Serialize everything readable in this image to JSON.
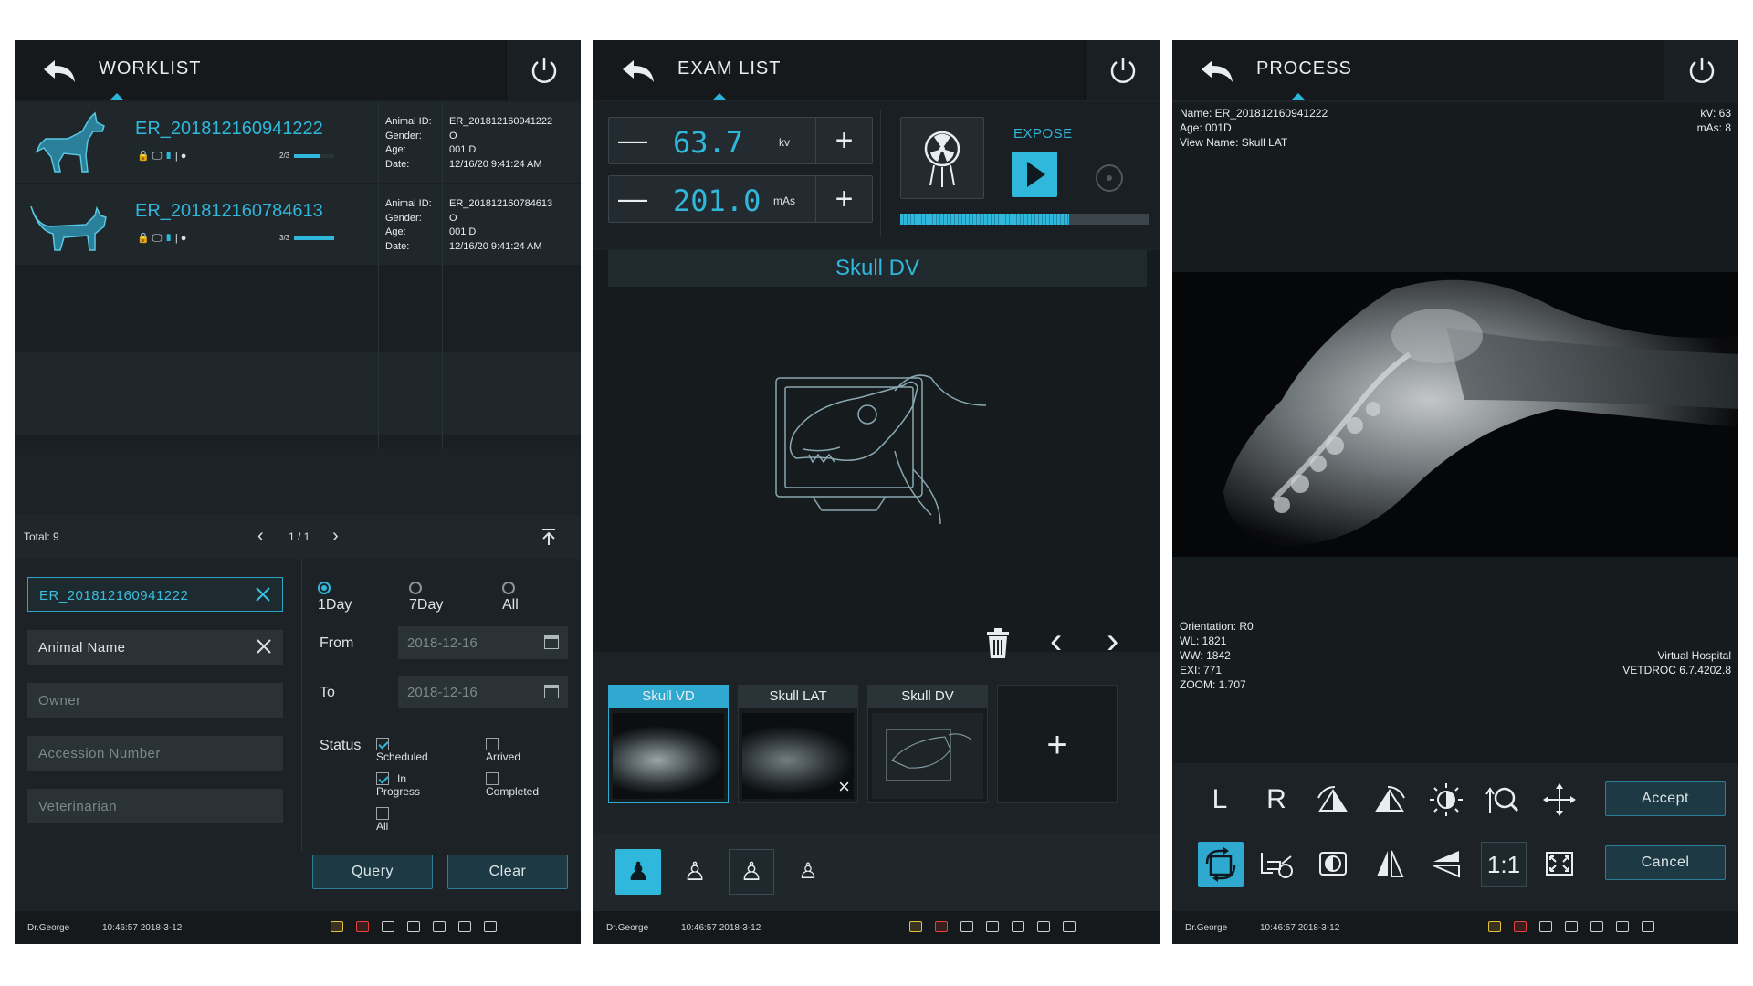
{
  "worklist": {
    "header": {
      "title": "WORKLIST"
    },
    "patients": [
      {
        "id": "ER_201812160941222",
        "animal_id_label": "Animal ID:",
        "animal_id": "ER_201812160941222",
        "gender_label": "Gender:",
        "gender": "O",
        "age_label": "Age:",
        "age": "001 D",
        "date_label": "Date:",
        "date": "12/16/20 9:41:24 AM",
        "progress": "2/3",
        "progress_value": 0.67
      },
      {
        "id": "ER_201812160784613",
        "animal_id_label": "Animal ID:",
        "animal_id": "ER_201812160784613",
        "gender_label": "Gender:",
        "gender": "O",
        "age_label": "Age:",
        "age": "001 D",
        "date_label": "Date:",
        "date": "12/16/20 9:41:24 AM",
        "progress": "3/3",
        "progress_value": 1.0
      }
    ],
    "total": "Total: 9",
    "pagination": "1 / 1",
    "search": {
      "id_value": "ER_201812160941222",
      "animal_name": "Animal Name",
      "owner_placeholder": "Owner",
      "accession_placeholder": "Accession Number",
      "veterinarian_placeholder": "Veterinarian"
    },
    "range": {
      "options": [
        "1Day",
        "7Day",
        "All"
      ],
      "selected": "1Day"
    },
    "from_label": "From",
    "from_value": "2018-12-16",
    "to_label": "To",
    "to_value": "2018-12-16",
    "status_label": "Status",
    "status": [
      {
        "label": "Scheduled",
        "checked": true
      },
      {
        "label": "Arrived",
        "checked": false
      },
      {
        "label": "In Progress",
        "checked": true
      },
      {
        "label": "Completed",
        "checked": false
      },
      {
        "label": "All",
        "checked": false
      }
    ],
    "query_label": "Query",
    "clear_label": "Clear"
  },
  "exam": {
    "header": {
      "title": "EXAM LIST"
    },
    "kv_value": "63.7",
    "kv_unit": "kv",
    "mas_value": "201.0",
    "mas_unit": "mAs",
    "expose_label": "EXPOSE",
    "expose_progress": 0.68,
    "view_title": "Skull DV",
    "thumbnails": [
      {
        "label": "Skull VD",
        "active": true
      },
      {
        "label": "Skull LAT",
        "active": false
      },
      {
        "label": "Skull DV",
        "active": false
      }
    ],
    "add_label": "+"
  },
  "process": {
    "header": {
      "title": "PROCESS"
    },
    "info": {
      "name": "Name: ER_201812160941222",
      "age": "Age: 001D",
      "view": "View Name: Skull LAT",
      "kv": "kV: 63",
      "mas": "mAs: 8",
      "orientation": "Orientation: R0",
      "wl": "WL: 1821",
      "ww": "WW: 1842",
      "exi": "EXI: 771",
      "zoom": "ZOOM: 1.707",
      "hospital": "Virtual Hospital",
      "version": "VETDROC 6.7.4202.8"
    },
    "tools": {
      "left": "L",
      "right": "R",
      "one_to_one": "1:1"
    },
    "accept_label": "Accept",
    "cancel_label": "Cancel"
  },
  "footer": {
    "user": "Dr.George",
    "time": "10:46:57  2018-3-12"
  },
  "colors": {
    "accent": "#2fb8db",
    "panel": "#1c2226",
    "header": "#15191c"
  }
}
